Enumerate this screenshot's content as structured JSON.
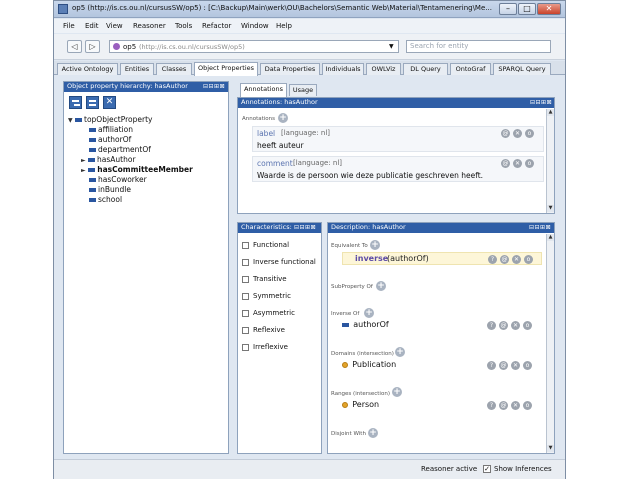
{
  "window": {
    "title": "op5 (http://is.cs.ou.nl/cursusSW/op5) : [C:\\Backup\\Main\\werk\\OU\\Bachelors\\Semantic Web\\Material\\Tentamenering\\Me...",
    "minimize": "–",
    "maximize": "□",
    "close": "✕"
  },
  "menu": [
    "File",
    "Edit",
    "View",
    "Reasoner",
    "Tools",
    "Refactor",
    "Window",
    "Help"
  ],
  "toolbar": {
    "back": "◁",
    "forward": "▷",
    "ontology": "op5",
    "ontology_iri": "(http://is.cs.ou.nl/cursusSW/op5)",
    "search_placeholder": "Search for entity"
  },
  "tabs": [
    "Active Ontology",
    "Entities",
    "Classes",
    "Object Properties",
    "Data Properties",
    "Individuals",
    "OWLViz",
    "DL Query",
    "OntoGraf",
    "SPARQL Query"
  ],
  "hierarchy": {
    "header": "Object property hierarchy: hasAuthor",
    "controls": "⊟⊟⊞⊠",
    "items": [
      {
        "label": "topObjectProperty",
        "expander": "▼"
      },
      {
        "label": "affiliation",
        "expander": ""
      },
      {
        "label": "authorOf",
        "expander": ""
      },
      {
        "label": "departmentOf",
        "expander": ""
      },
      {
        "label": "hasAuthor",
        "expander": "►"
      },
      {
        "label": "hasCommitteeMember",
        "expander": "►"
      },
      {
        "label": "hasCoworker",
        "expander": ""
      },
      {
        "label": "inBundle",
        "expander": ""
      },
      {
        "label": "school",
        "expander": ""
      }
    ]
  },
  "annotations_tabs": [
    "Annotations",
    "Usage"
  ],
  "annotations": {
    "header": "Annotations: hasAuthor",
    "section": "Annotations",
    "items": [
      {
        "prop": "label",
        "lang": "[language: nl]",
        "value": "heeft auteur"
      },
      {
        "prop": "comment",
        "lang": "[language: nl]",
        "value": "Waarde is de persoon wie deze publicatie geschreven heeft."
      }
    ]
  },
  "characteristics": {
    "header": "Characteristics: ",
    "items": [
      "Functional",
      "Inverse functional",
      "Transitive",
      "Symmetric",
      "Asymmetric",
      "Reflexive",
      "Irreflexive"
    ]
  },
  "description": {
    "header": "Description: hasAuthor",
    "equivalent_to": "Equivalent To",
    "inverse_keyword": "inverse",
    "inverse_expr": "(authorOf)",
    "subproperty_of": "SubProperty Of",
    "inverse_of": "Inverse Of",
    "inverse_of_value": "authorOf",
    "domains": "Domains (intersection)",
    "domain_value": "Publication",
    "ranges": "Ranges (intersection)",
    "range_value": "Person",
    "disjoint_with": "Disjoint With"
  },
  "status": {
    "reasoner": "Reasoner active",
    "show_inferences": "Show Inferences"
  },
  "colors": {
    "panel_header": "#2f5ea6",
    "property_icon": "#2a56a0",
    "class_icon": "#e2a32a"
  }
}
